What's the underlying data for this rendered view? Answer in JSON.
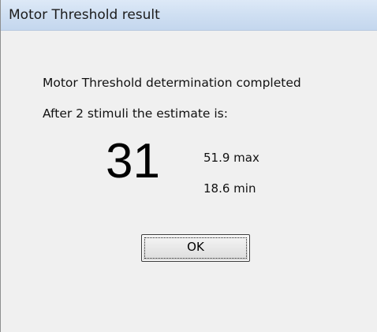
{
  "window": {
    "title": "Motor Threshold result"
  },
  "message": {
    "line1": "Motor Threshold determination completed",
    "line2": "After 2 stimuli the estimate is:"
  },
  "result": {
    "estimate": "31",
    "max_label": "51.9 max",
    "min_label": "18.6 min"
  },
  "buttons": {
    "ok_label": "OK"
  }
}
